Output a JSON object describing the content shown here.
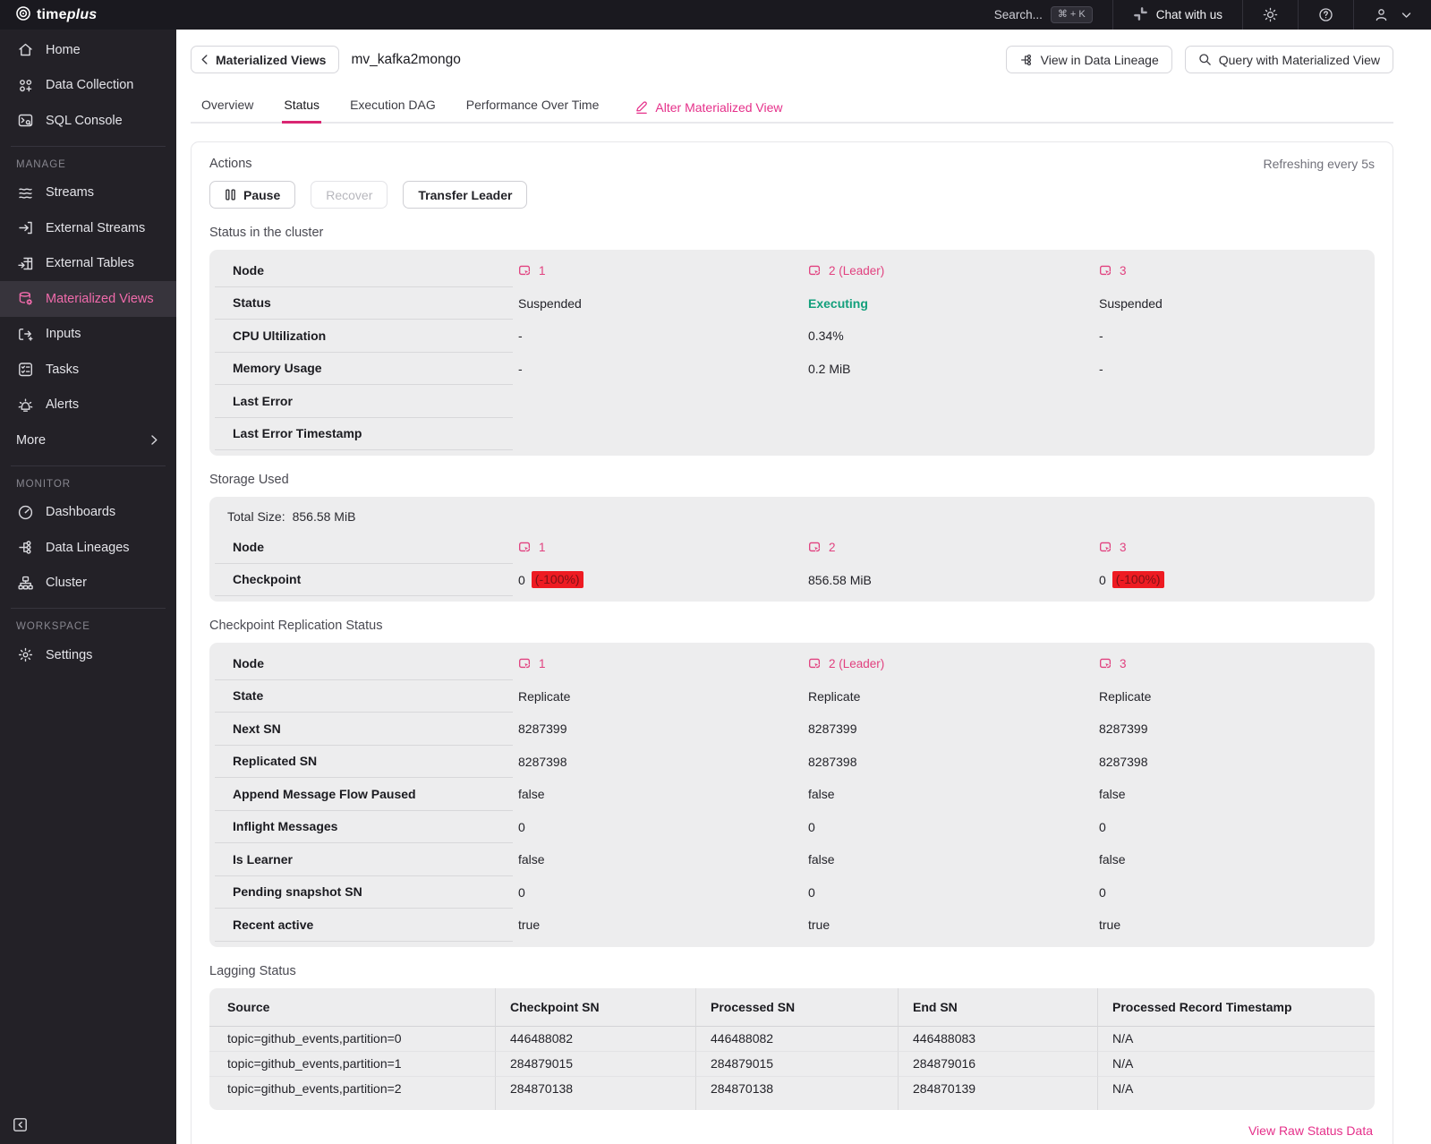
{
  "topbar": {
    "brand_time": "time",
    "brand_plus": "plus",
    "search_label": "Search...",
    "search_shortcut": "⌘ + K",
    "chat_label": "Chat with us"
  },
  "sidebar": {
    "home": "Home",
    "data_collection": "Data Collection",
    "sql_console": "SQL Console",
    "manage": "MANAGE",
    "streams": "Streams",
    "external_streams": "External Streams",
    "external_tables": "External Tables",
    "materialized_views": "Materialized Views",
    "inputs": "Inputs",
    "tasks": "Tasks",
    "alerts": "Alerts",
    "more": "More",
    "monitor": "MONITOR",
    "dashboards": "Dashboards",
    "data_lineages": "Data Lineages",
    "cluster": "Cluster",
    "workspace": "WORKSPACE",
    "settings": "Settings"
  },
  "header": {
    "back": "Materialized Views",
    "title": "mv_kafka2mongo",
    "view_lineage": "View in Data Lineage",
    "query_mv": "Query with Materialized View"
  },
  "tabs": {
    "overview": "Overview",
    "status": "Status",
    "execution_dag": "Execution DAG",
    "performance": "Performance Over Time",
    "alter": "Alter Materialized View",
    "active": "Status"
  },
  "actions": {
    "title": "Actions",
    "pause": "Pause",
    "recover": "Recover",
    "transfer_leader": "Transfer Leader",
    "refreshing": "Refreshing every 5s"
  },
  "cluster_status": {
    "title": "Status in the cluster",
    "labels": {
      "node": "Node",
      "status": "Status",
      "cpu": "CPU Ultilization",
      "memory": "Memory Usage",
      "last_error": "Last Error",
      "last_error_ts": "Last Error Timestamp"
    },
    "nodes": [
      "1",
      "2 (Leader)",
      "3"
    ],
    "status": [
      "Suspended",
      "Executing",
      "Suspended"
    ],
    "cpu": [
      "-",
      "0.34%",
      "-"
    ],
    "memory": [
      "-",
      "0.2 MiB",
      "-"
    ],
    "last_error": [
      "",
      "",
      ""
    ],
    "last_error_ts": [
      "",
      "",
      ""
    ]
  },
  "storage": {
    "title": "Storage Used",
    "total_label": "Total Size:",
    "total_value": "856.58 MiB",
    "node_label": "Node",
    "checkpoint_label": "Checkpoint",
    "nodes": [
      "1",
      "2",
      "3"
    ],
    "checkpoint_values": [
      "0",
      "856.58 MiB",
      "0"
    ],
    "checkpoint_badges": [
      "(-100%)",
      "",
      "(-100%)"
    ]
  },
  "replication": {
    "title": "Checkpoint Replication Status",
    "labels": {
      "node": "Node",
      "state": "State",
      "next_sn": "Next SN",
      "replicated_sn": "Replicated SN",
      "append_paused": "Append Message Flow Paused",
      "inflight": "Inflight Messages",
      "is_learner": "Is Learner",
      "pending_sn": "Pending snapshot SN",
      "recent_active": "Recent active"
    },
    "nodes": [
      "1",
      "2 (Leader)",
      "3"
    ],
    "state": [
      "Replicate",
      "Replicate",
      "Replicate"
    ],
    "next_sn": [
      "8287399",
      "8287399",
      "8287399"
    ],
    "replicated_sn": [
      "8287398",
      "8287398",
      "8287398"
    ],
    "append_paused": [
      "false",
      "false",
      "false"
    ],
    "inflight": [
      "0",
      "0",
      "0"
    ],
    "is_learner": [
      "false",
      "false",
      "false"
    ],
    "pending_sn": [
      "0",
      "0",
      "0"
    ],
    "recent_active": [
      "true",
      "true",
      "true"
    ]
  },
  "lagging": {
    "title": "Lagging Status",
    "headers": [
      "Source",
      "Checkpoint SN",
      "Processed SN",
      "End SN",
      "Processed Record Timestamp"
    ],
    "rows": [
      [
        "topic=github_events,partition=0",
        "446488082",
        "446488082",
        "446488083",
        "N/A"
      ],
      [
        "topic=github_events,partition=1",
        "284879015",
        "284879015",
        "284879016",
        "N/A"
      ],
      [
        "topic=github_events,partition=2",
        "284870138",
        "284870138",
        "284870139",
        "N/A"
      ]
    ]
  },
  "footer": {
    "view_raw": "View Raw Status Data"
  },
  "colors": {
    "accent_pink": "#e5308a",
    "node_pink": "#e1417f",
    "executing_green": "#13a07c",
    "badge_red_bg": "#ee1b22",
    "badge_red_text": "#7c1216",
    "sidebar_bg": "#232127",
    "topbar_bg": "#1a191f",
    "table_bg": "#ededee"
  }
}
